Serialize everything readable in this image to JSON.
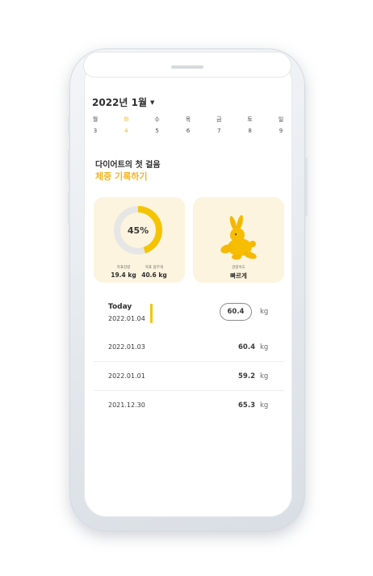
{
  "calendar": {
    "month_label": "2022년 1월",
    "days": [
      {
        "weekday": "월",
        "date": "3",
        "active": false
      },
      {
        "weekday": "화",
        "date": "4",
        "active": true
      },
      {
        "weekday": "수",
        "date": "5",
        "active": false
      },
      {
        "weekday": "목",
        "date": "6",
        "active": false
      },
      {
        "weekday": "금",
        "date": "7",
        "active": false
      },
      {
        "weekday": "토",
        "date": "8",
        "active": false
      },
      {
        "weekday": "일",
        "date": "9",
        "active": false
      }
    ]
  },
  "intro": {
    "title": "다이어트의 첫 걸음",
    "subtitle": "체중 기록하기"
  },
  "progress_card": {
    "percent_label": "45%",
    "percent_value": 45,
    "stats": [
      {
        "label": "목표감량",
        "value": "19.4 kg"
      },
      {
        "label": "목표 몸무게",
        "value": "40.6 kg"
      }
    ]
  },
  "speed_card": {
    "label": "감량속도",
    "value": "빠르게"
  },
  "today": {
    "title": "Today",
    "date": "2022.01.04",
    "weight": "60.4",
    "unit": "kg"
  },
  "history": [
    {
      "date": "2022.01.03",
      "weight": "60.4",
      "unit": "kg"
    },
    {
      "date": "2022.01.01",
      "weight": "59.2",
      "unit": "kg"
    },
    {
      "date": "2021.12.30",
      "weight": "65.3",
      "unit": "kg"
    }
  ],
  "colors": {
    "accent": "#f5c400",
    "card_bg": "#fcf4de",
    "track": "#e6e6e6"
  }
}
